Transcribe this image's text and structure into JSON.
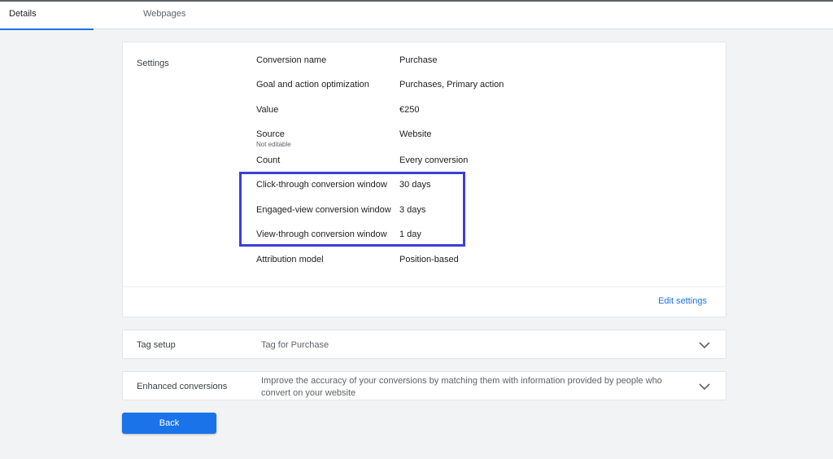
{
  "tabs": [
    {
      "label": "Details",
      "active": true
    },
    {
      "label": "Webpages",
      "active": false
    }
  ],
  "settings": {
    "title": "Settings",
    "rows": [
      {
        "label": "Conversion name",
        "value": "Purchase"
      },
      {
        "label": "Goal and action optimization",
        "value": "Purchases, Primary action"
      },
      {
        "label": "Value",
        "value": "€250"
      },
      {
        "label": "Source",
        "sublabel": "Not editable",
        "value": "Website"
      },
      {
        "label": "Count",
        "value": "Every conversion"
      },
      {
        "label": "Click-through conversion window",
        "value": "30 days"
      },
      {
        "label": "Engaged-view conversion window",
        "value": "3 days"
      },
      {
        "label": "View-through conversion window",
        "value": "1 day"
      },
      {
        "label": "Attribution model",
        "value": "Position-based"
      }
    ],
    "edit_label": "Edit settings"
  },
  "tag_setup": {
    "title": "Tag setup",
    "description": "Tag for Purchase"
  },
  "enhanced_conversions": {
    "title": "Enhanced conversions",
    "description": "Improve the accuracy of your conversions by matching them with information provided by people who convert on your website"
  },
  "back_label": "Back",
  "icons": {
    "expand": "chevron-down-icon"
  },
  "colors": {
    "accent": "#1a73e8",
    "highlight": "#3b3fd6",
    "background": "#f1f3f4"
  }
}
